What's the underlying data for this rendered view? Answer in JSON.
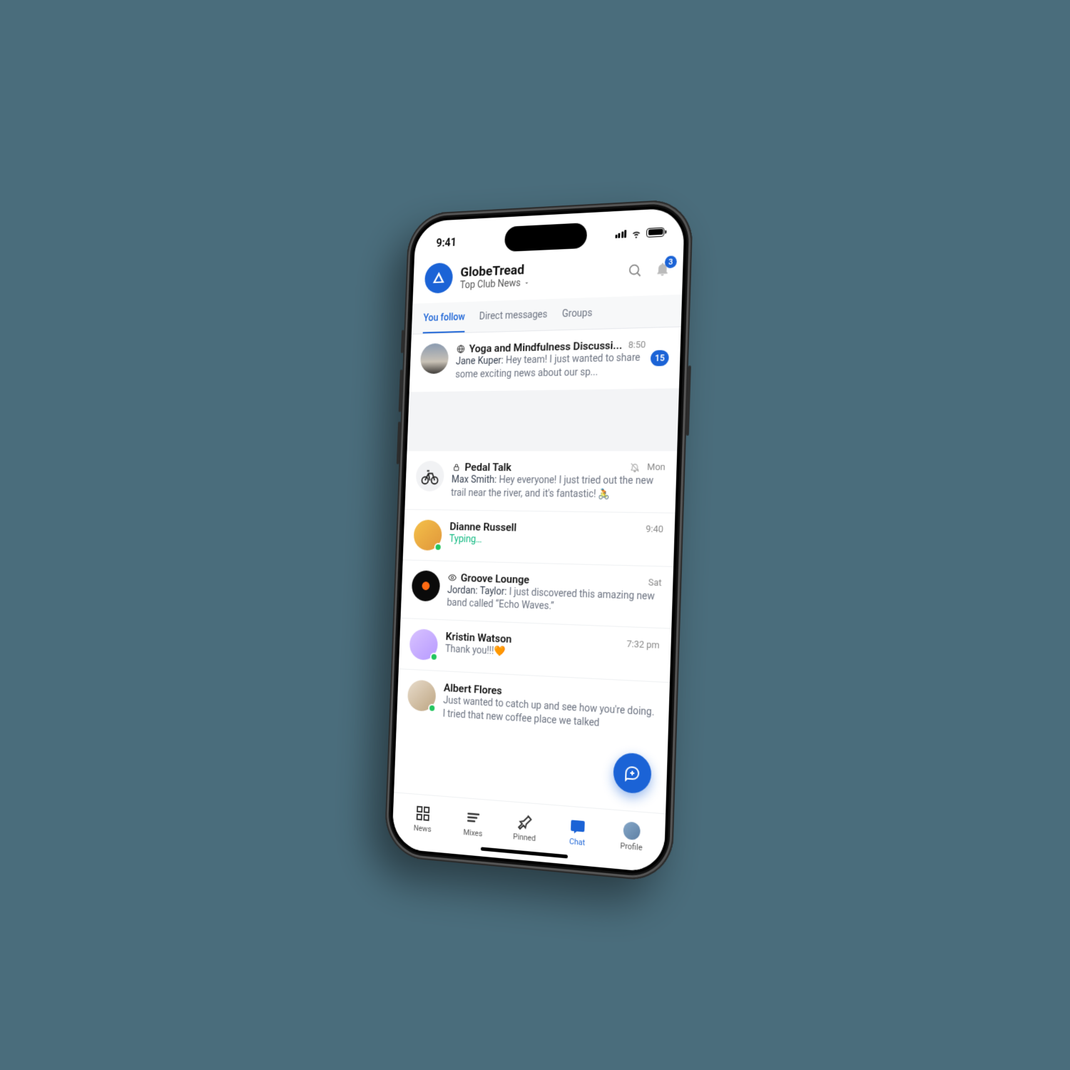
{
  "status": {
    "time": "9:41"
  },
  "header": {
    "app_name": "GlobeTread",
    "subtitle": "Top Club News",
    "notification_count": "3"
  },
  "tabs": {
    "follow": "You follow",
    "dm": "Direct messages",
    "groups": "Groups"
  },
  "chats": {
    "yoga": {
      "icon_name": "globe",
      "title": "Yoga and Mindfulness Discussi...",
      "time": "8:50",
      "sender": "Jane Kuper:",
      "preview": " Hey team! I just wanted to share some exciting news about our sp...",
      "unread": "15"
    },
    "pedal": {
      "icon_name": "lock",
      "title": "Pedal Talk",
      "time": "Mon",
      "muted": true,
      "sender": "Max Smith:",
      "preview": " Hey everyone! I just tried out the new trail near the river, and it's fantastic! 🚴"
    },
    "dianne": {
      "title": "Dianne Russell",
      "time": "9:40",
      "typing": "Typing…",
      "online": true
    },
    "groove": {
      "icon_name": "eye",
      "title": "Groove Lounge",
      "time": "Sat",
      "sender": "Jordan: Taylor:",
      "preview": " I just discovered this amazing new band called “Echo Waves.”"
    },
    "kristin": {
      "title": "Kristin Watson",
      "time": "7:32 pm",
      "preview": "Thank you!!!🧡",
      "online": true
    },
    "albert": {
      "title": "Albert Flores",
      "preview": "Just wanted to catch up and see how you're doing. I tried that new coffee place we talked",
      "online": true
    }
  },
  "nav": {
    "news": "News",
    "mixes": "Mixes",
    "pinned": "Pinned",
    "chat": "Chat",
    "profile": "Profile"
  }
}
